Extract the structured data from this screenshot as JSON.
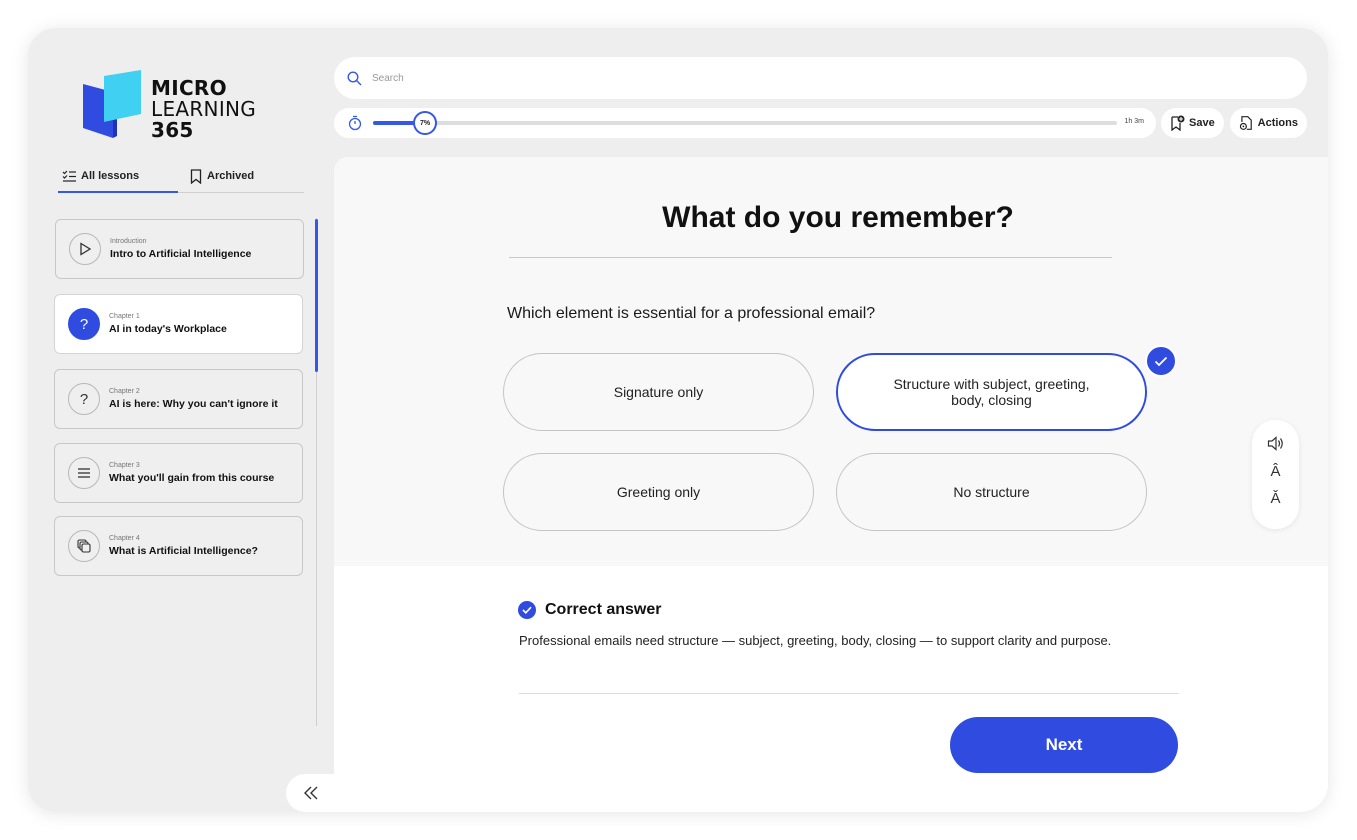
{
  "brand": {
    "line1": "MICRO",
    "line2": "LEARNING",
    "line3": "365"
  },
  "sidebar": {
    "tabs": [
      {
        "label": "All lessons",
        "active": true
      },
      {
        "label": "Archived",
        "active": false
      }
    ],
    "lessons": [
      {
        "kicker": "Introduction",
        "title": "Intro to Artificial Intelligence",
        "icon": "play-icon",
        "active": false
      },
      {
        "kicker": "Chapter 1",
        "title": "AI in today's Workplace",
        "icon": "question-icon",
        "active": true
      },
      {
        "kicker": "Chapter 2",
        "title": "AI is here: Why you can't ignore it",
        "icon": "question-icon",
        "active": false
      },
      {
        "kicker": "Chapter 3",
        "title": "What you'll gain from this course",
        "icon": "list-icon",
        "active": false
      },
      {
        "kicker": "Chapter 4",
        "title": "What is Artificial Intelligence?",
        "icon": "layers-icon",
        "active": false
      }
    ]
  },
  "search": {
    "placeholder": "Search"
  },
  "progress": {
    "percent": 7,
    "label": "7%",
    "duration": "1h 3m"
  },
  "toolbar": {
    "save_label": "Save",
    "actions_label": "Actions"
  },
  "quiz": {
    "title": "What do you remember?",
    "question": "Which element is essential for a professional email?",
    "options": [
      {
        "label": "Signature only",
        "selected": false
      },
      {
        "label": "Structure with subject, greeting, body, closing",
        "selected": true
      },
      {
        "label": "Greeting only",
        "selected": false
      },
      {
        "label": "No structure",
        "selected": false
      }
    ]
  },
  "feedback": {
    "heading": "Correct answer",
    "text": "Professional emails need structure — subject, greeting, body, closing — to support clarity and purpose."
  },
  "next_label": "Next",
  "colors": {
    "accent": "#2f4be0",
    "frame": "#eeeeee",
    "panel": "#f8f8f8"
  }
}
